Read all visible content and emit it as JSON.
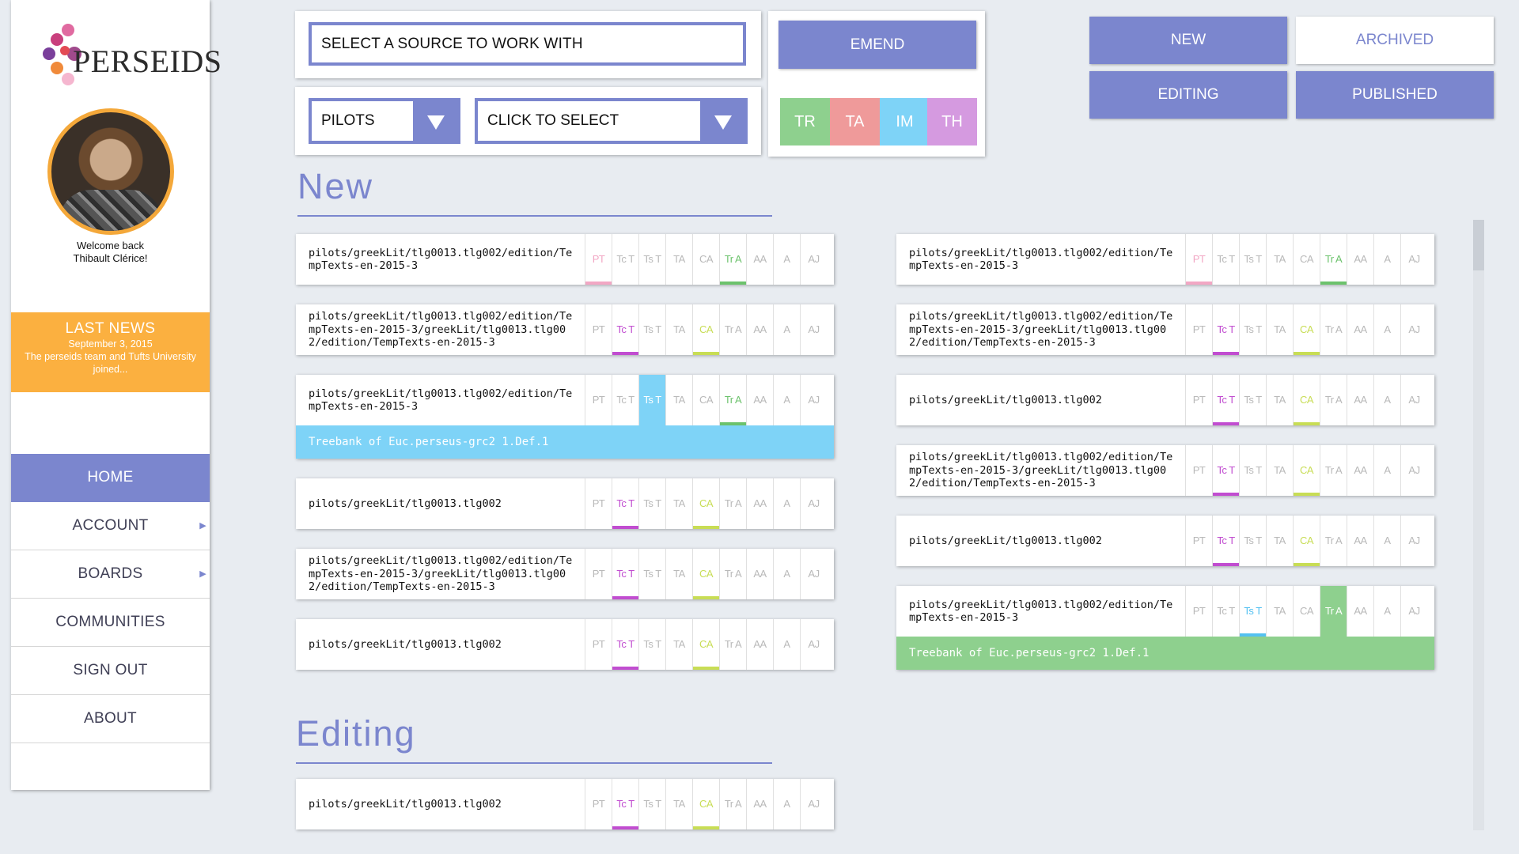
{
  "colors": {
    "accent": "#7b86ce",
    "news_bg": "#fbb040",
    "tr": "#8ed08e",
    "ta": "#ef9a9a",
    "im": "#7ed3f7",
    "th": "#d59ae0",
    "pink": "#f2a7c4",
    "purple": "#c14dd0",
    "lime": "#c8dd55",
    "green": "#6cc26c",
    "blue": "#54c1f1"
  },
  "sidebar": {
    "logo_text": "PERSEIDS",
    "avatar_icon": "user-avatar",
    "welcome_line1": "Welcome back",
    "welcome_line2": "Thibault Clérice!",
    "news": {
      "title": "LAST NEWS",
      "date": "September 3, 2015",
      "body": "The perseids team and Tufts University joined..."
    },
    "nav": [
      {
        "label": "HOME",
        "active": true,
        "submenu": false
      },
      {
        "label": "ACCOUNT",
        "active": false,
        "submenu": true
      },
      {
        "label": "BOARDS",
        "active": false,
        "submenu": true
      },
      {
        "label": "COMMUNITIES",
        "active": false,
        "submenu": false
      },
      {
        "label": "SIGN OUT",
        "active": false,
        "submenu": false
      },
      {
        "label": "ABOUT",
        "active": false,
        "submenu": false
      }
    ]
  },
  "controls": {
    "source_placeholder": "SELECT A SOURCE TO WORK WITH",
    "collection_dropdown": "PILOTS",
    "item_dropdown": "CLICK TO SELECT",
    "emend_label": "EMEND",
    "type_buttons": [
      {
        "label": "TR",
        "color": "#8ed08e"
      },
      {
        "label": "TA",
        "color": "#ef9a9a"
      },
      {
        "label": "IM",
        "color": "#7ed3f7"
      },
      {
        "label": "TH",
        "color": "#d59ae0"
      }
    ],
    "filters": {
      "new": "NEW",
      "archived": "ARCHIVED",
      "editing": "EDITING",
      "published": "PUBLISHED"
    }
  },
  "tag_labels": [
    "PT",
    "Tc T",
    "Ts T",
    "TA",
    "CA",
    "Tr A",
    "AA",
    "A",
    "AJ"
  ],
  "sections": {
    "new_title": "New",
    "editing_title": "Editing"
  },
  "new_cards_left": [
    {
      "path": "pilots/greekLit/tlg0013.tlg002/edition/TempTexts-en-2015-3",
      "highlights": {
        "PT": "pink",
        "Tr A": "green"
      }
    },
    {
      "path": "pilots/greekLit/tlg0013.tlg002/edition/TempTexts-en-2015-3/greekLit/tlg0013.tlg002/edition/TempTexts-en-2015-3",
      "highlights": {
        "Tc T": "purple",
        "CA": "lime"
      }
    },
    {
      "path": "pilots/greekLit/tlg0013.tlg002/edition/TempTexts-en-2015-3",
      "highlights": {
        "Ts T": "blue-fill",
        "Tr A": "green"
      },
      "footer": "Treebank of Euc.perseus-grc2 1.Def.1",
      "footer_color": "#7ed3f7"
    },
    {
      "path": "pilots/greekLit/tlg0013.tlg002",
      "highlights": {
        "Tc T": "purple",
        "CA": "lime"
      }
    },
    {
      "path": "pilots/greekLit/tlg0013.tlg002/edition/TempTexts-en-2015-3/greekLit/tlg0013.tlg002/edition/TempTexts-en-2015-3",
      "highlights": {
        "Tc T": "purple",
        "CA": "lime"
      }
    },
    {
      "path": "pilots/greekLit/tlg0013.tlg002",
      "highlights": {
        "Tc T": "purple",
        "CA": "lime"
      }
    }
  ],
  "new_cards_right": [
    {
      "path": "pilots/greekLit/tlg0013.tlg002/edition/TempTexts-en-2015-3",
      "highlights": {
        "PT": "pink",
        "Tr A": "green"
      }
    },
    {
      "path": "pilots/greekLit/tlg0013.tlg002/edition/TempTexts-en-2015-3/greekLit/tlg0013.tlg002/edition/TempTexts-en-2015-3",
      "highlights": {
        "Tc T": "purple",
        "CA": "lime"
      }
    },
    {
      "path": "pilots/greekLit/tlg0013.tlg002",
      "highlights": {
        "Tc T": "purple",
        "CA": "lime"
      }
    },
    {
      "path": "pilots/greekLit/tlg0013.tlg002/edition/TempTexts-en-2015-3/greekLit/tlg0013.tlg002/edition/TempTexts-en-2015-3",
      "highlights": {
        "Tc T": "purple",
        "CA": "lime"
      }
    },
    {
      "path": "pilots/greekLit/tlg0013.tlg002",
      "highlights": {
        "Tc T": "purple",
        "CA": "lime"
      }
    },
    {
      "path": "pilots/greekLit/tlg0013.tlg002/edition/TempTexts-en-2015-3",
      "highlights": {
        "Ts T": "blue",
        "Tr A": "green-fill"
      },
      "footer": "Treebank of Euc.perseus-grc2 1.Def.1",
      "footer_color": "#8ed08e"
    }
  ],
  "editing_cards": [
    {
      "path": "pilots/greekLit/tlg0013.tlg002",
      "highlights": {
        "Tc T": "purple",
        "CA": "lime"
      }
    }
  ]
}
